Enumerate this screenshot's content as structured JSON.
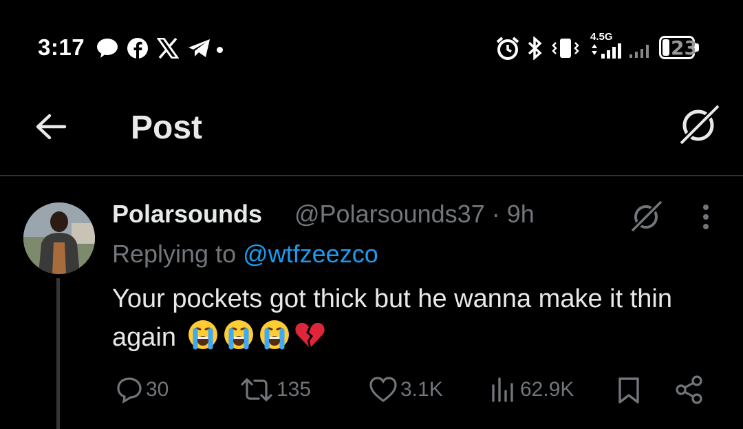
{
  "status_bar": {
    "time": "3:17",
    "network": "4.5G",
    "battery": "23",
    "icons": [
      "chat-bubble-icon",
      "facebook-icon",
      "x-logo-icon",
      "telegram-icon",
      "dot-icon",
      "alarm-icon",
      "bluetooth-icon",
      "vibrate-icon",
      "signal-icon",
      "signal-icon-2",
      "battery-icon"
    ]
  },
  "header": {
    "title": "Post",
    "back_icon": "arrow-left-icon",
    "grok_icon": "grok-icon"
  },
  "post": {
    "author_name": "Polarsounds",
    "handle_time": "@Polarsounds37 · 9h",
    "replying_prefix": "Replying to ",
    "replying_to": "@wtfzeezco",
    "text": "Your pockets got thick but he wanna make it thin again",
    "emojis": [
      "loudly-crying-face",
      "loudly-crying-face",
      "loudly-crying-face",
      "broken-heart"
    ],
    "actions": {
      "replies": "30",
      "reposts": "135",
      "likes": "3.1K",
      "views": "62.9K"
    }
  },
  "colors": {
    "background": "#000000",
    "text": "#e7e9ea",
    "muted": "#71767b",
    "link": "#1d9bf0"
  }
}
